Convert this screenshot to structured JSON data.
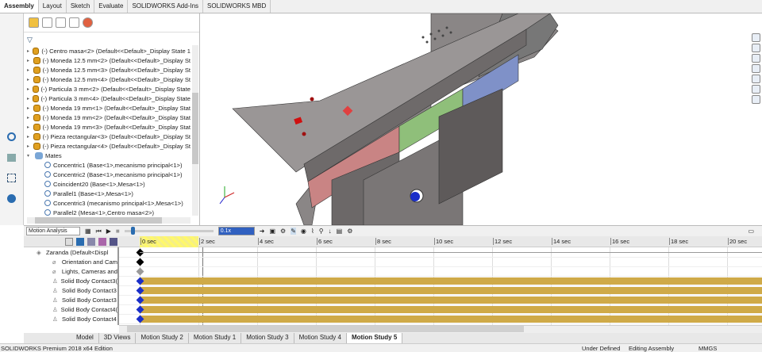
{
  "ribbon_tabs": [
    "Assembly",
    "Layout",
    "Sketch",
    "Evaluate",
    "SOLIDWORKS Add-Ins",
    "SOLIDWORKS MBD"
  ],
  "tree": {
    "items": [
      "(-) Centro masa<2> (Default<<Default>_Display State 1",
      "(-) Moneda 12.5 mm<2> (Default<<Default>_Display St",
      "(-) Moneda 12.5 mm<3> (Default<<Default>_Display St",
      "(-) Moneda 12.5 mm<4> (Default<<Default>_Display St",
      "(-) Particula 3 mm<2> (Default<<Default>_Display State",
      "(-) Particula 3 mm<4> (Default<<Default>_Display State",
      "(-) Moneda 19 mm<1> (Default<<Default>_Display Stat",
      "(-) Moneda 19 mm<2> (Default<<Default>_Display Stat",
      "(-) Moneda 19 mm<3> (Default<<Default>_Display Stat",
      "(-) Pieza rectangular<3> (Default<<Default>_Display St",
      "(-) Pieza rectangular<4> (Default<<Default>_Display St"
    ],
    "mates_label": "Mates",
    "mates": [
      "Concentric1 (Base<1>,mecanismo principal<1>)",
      "Concentric2 (Base<1>,mecanismo principal<1>)",
      "Coincident20 (Base<1>,Mesa<1>)",
      "Parallel1 (Base<1>,Mesa<1>)",
      "Concentric3 (mecanismo principal<1>,Mesa<1>)",
      "Parallel2 (Mesa<1>,Centro masa<2>)"
    ]
  },
  "motion": {
    "study_type": "Motion Analysis",
    "playback_speed": "0.1x",
    "time_labels": [
      "0 sec",
      "2 sec",
      "4 sec",
      "6 sec",
      "8 sec",
      "10 sec",
      "12 sec",
      "14 sec",
      "16 sec",
      "18 sec",
      "20 sec"
    ],
    "rows": [
      "Zaranda  (Default<Displ",
      "Orientation and Cam",
      "Lights, Cameras and",
      "Solid Body Contact3(",
      "Solid Body Contact3",
      "Solid Body Contact3",
      "Solid Body Contact4(",
      "Solid Body Contact4"
    ],
    "bar_color": "#cfaa48"
  },
  "bottom_tabs": [
    "Model",
    "3D Views",
    "Motion Study 2",
    "Motion Study 1",
    "Motion Study 3",
    "Motion Study 4",
    "Motion Study 5"
  ],
  "active_bottom_tab": "Motion Study 5",
  "status": {
    "edition": "SOLIDWORKS Premium 2018 x64 Edition",
    "state": "Under Defined",
    "mode": "Editing Assembly",
    "units": "MMGS"
  }
}
